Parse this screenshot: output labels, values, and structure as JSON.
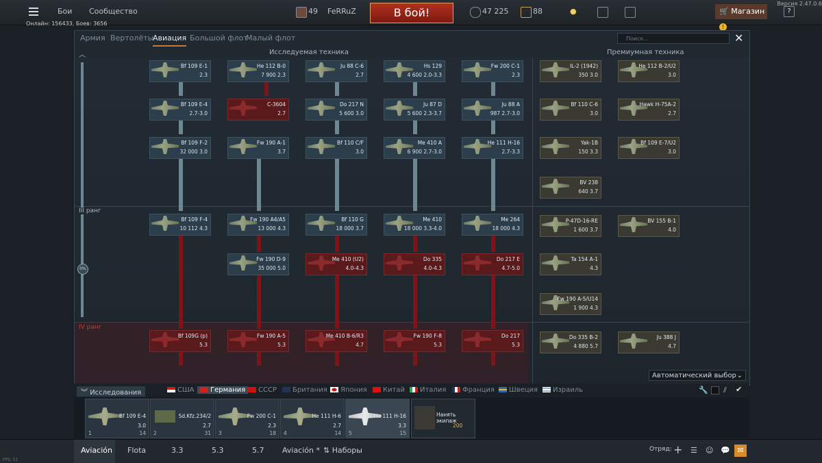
{
  "topbar": {
    "menu_items": [
      "Бои",
      "Сообщество"
    ],
    "rank": "49",
    "username": "FeRRuZ",
    "battle_button": "В бой!",
    "silver_lions": "47 225",
    "golden_eagles": "88",
    "shop_label": "Магазин",
    "shop_badge": "!",
    "help_label": "?",
    "online_line": "Онлайн: 156433, Боев: 3656",
    "version": "Версия 2.47.0.6"
  },
  "main": {
    "nav_tabs": [
      "Армия",
      "Вертолёты",
      "Авиация",
      "Большой флот",
      "Малый флот"
    ],
    "active_tab": "Авиация",
    "search_placeholder": "Поиск...",
    "researched_header": "Исследуемая техника",
    "premium_header": "Премиумная техника",
    "rank3_label": "III ранг",
    "rank4_label": "IV ранг",
    "progress_label": "0%",
    "auto_select": "Автоматический выбор"
  },
  "tree": [
    {
      "name": "Bf 109 E-1",
      "stats": "2.3"
    },
    {
      "name": "He 112 B-0",
      "stats": "7 900 2.3"
    },
    {
      "name": "Ju 88 C-6",
      "stats": "2.7"
    },
    {
      "name": "Hs 129",
      "stats": "4 600 2.0-3.3"
    },
    {
      "name": "Fw 200 C-1",
      "stats": "2.3"
    },
    {
      "name": "Bf 109 E-4",
      "stats": "2.7-3.0"
    },
    {
      "name": "C-3604",
      "stats": "2.7"
    },
    {
      "name": "Do 217 N",
      "stats": "5 600 3.0"
    },
    {
      "name": "Ju 87 D",
      "stats": "5 600 2.3-3.7"
    },
    {
      "name": "Ju 88 A",
      "stats": "987 2.7-3.0"
    },
    {
      "name": "Bf 109 F-2",
      "stats": "32 000 3.0"
    },
    {
      "name": "Fw 190 A-1",
      "stats": "3.7"
    },
    {
      "name": "Bf 110 C/F",
      "stats": "3.0"
    },
    {
      "name": "Me 410 A",
      "stats": "6 900 2.7-3.0"
    },
    {
      "name": "He 111 H-16",
      "stats": "2.7-3.3"
    },
    {
      "name": "Bf 109 F-4",
      "stats": "10 112 4.3"
    },
    {
      "name": "Fw 190 A4/A5",
      "stats": "13 000 4.3"
    },
    {
      "name": "Bf 110 G",
      "stats": "18 000 3.7"
    },
    {
      "name": "Me 410",
      "stats": "18 000 3.3-4.0"
    },
    {
      "name": "Me 264",
      "stats": "18 000 4.3"
    },
    {
      "name": "Fw 190 D-9",
      "stats": "35 000 5.0"
    },
    {
      "name": "Me 410 (U2)",
      "stats": "4.0-4.3"
    },
    {
      "name": "Do 335",
      "stats": "4.0-4.3"
    },
    {
      "name": "Do 217 E",
      "stats": "4.7-5.0"
    },
    {
      "name": "Bf 109G (p)",
      "stats": "5.3"
    },
    {
      "name": "Fw 190 A-5",
      "stats": "5.3"
    },
    {
      "name": "Me 410 B-6/R3",
      "stats": "4.7"
    },
    {
      "name": "Fw 190 F-8",
      "stats": "5.3"
    },
    {
      "name": "Do 217",
      "stats": "5.3"
    }
  ],
  "premium": [
    {
      "name": "IL-2 (1942)",
      "stats": "350 3.0"
    },
    {
      "name": "He 112 B-2/U2",
      "stats": "3.0"
    },
    {
      "name": "Bf 110 C-6",
      "stats": "3.0"
    },
    {
      "name": "Hawk H-75A-2",
      "stats": "2.7"
    },
    {
      "name": "Yak-1B",
      "stats": "150 3.3"
    },
    {
      "name": "Bf 109 E-7/U2",
      "stats": "3.0"
    },
    {
      "name": "BV 238",
      "stats": "640 3.7"
    },
    {
      "name": "P-47D-16-RE",
      "stats": "1 600 3.7"
    },
    {
      "name": "BV 155 B-1",
      "stats": "4.0"
    },
    {
      "name": "Ta 154 A-1",
      "stats": "4.3"
    },
    {
      "name": "Fw 190 A-5/U14",
      "stats": "1 900 4.3"
    },
    {
      "name": "Do 335 B-2",
      "stats": "4 880 5.7"
    },
    {
      "name": "Ju 388 J",
      "stats": "4.7"
    }
  ],
  "nations": {
    "research_label": "Исследования",
    "list": [
      "США",
      "Германия",
      "СССР",
      "Британия",
      "Япония",
      "Китай",
      "Италия",
      "Франция",
      "Швеция",
      "Израиль"
    ],
    "active": "Германия"
  },
  "crew": [
    {
      "name": "Bf 109 E-4",
      "br": "3.0",
      "num": "1",
      "count": "14"
    },
    {
      "name": "Sd.Kfz.234/2",
      "br": "2.7",
      "num": "2",
      "count": "31"
    },
    {
      "name": "Fw 200 C-1",
      "br": "2.3",
      "num": "3",
      "count": "18"
    },
    {
      "name": "He 111 H-6",
      "br": "2.7",
      "num": "4",
      "count": "14"
    },
    {
      "name": "He 111 H-16",
      "br": "3.3",
      "num": "5",
      "count": "15"
    }
  ],
  "hire_crew": {
    "label": "Нанять экипаж",
    "cost": "200"
  },
  "bottombar": {
    "tabs": [
      "Aviación",
      "Flota",
      "3.3",
      "5.3",
      "5.7",
      "Aviación *",
      "Наборы"
    ],
    "squad_label": "Отряд:",
    "fps": "FPS: 51"
  }
}
